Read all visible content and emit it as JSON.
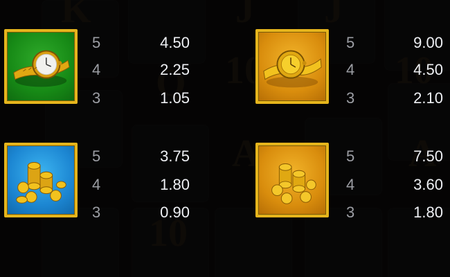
{
  "background_letters": [
    "K",
    "J",
    "J",
    "Q",
    "A",
    "A",
    "10",
    "10",
    "10"
  ],
  "colors": {
    "frame_gold": "#e6b51c",
    "multiplier_text": "#9c9ea4",
    "value_text": "#eef0f4"
  },
  "paytable": [
    {
      "symbol": "silver-watch-icon",
      "card": "green",
      "rows": [
        {
          "count": "5",
          "payout": "4.50"
        },
        {
          "count": "4",
          "payout": "2.25"
        },
        {
          "count": "3",
          "payout": "1.05"
        }
      ]
    },
    {
      "symbol": "gold-watch-icon",
      "card": "gold",
      "rows": [
        {
          "count": "5",
          "payout": "9.00"
        },
        {
          "count": "4",
          "payout": "4.50"
        },
        {
          "count": "3",
          "payout": "2.10"
        }
      ]
    },
    {
      "symbol": "coin-pile-blue-icon",
      "card": "blue",
      "rows": [
        {
          "count": "5",
          "payout": "3.75"
        },
        {
          "count": "4",
          "payout": "1.80"
        },
        {
          "count": "3",
          "payout": "0.90"
        }
      ]
    },
    {
      "symbol": "coin-pile-gold-icon",
      "card": "gold",
      "rows": [
        {
          "count": "5",
          "payout": "7.50"
        },
        {
          "count": "4",
          "payout": "3.60"
        },
        {
          "count": "3",
          "payout": "1.80"
        }
      ]
    }
  ]
}
